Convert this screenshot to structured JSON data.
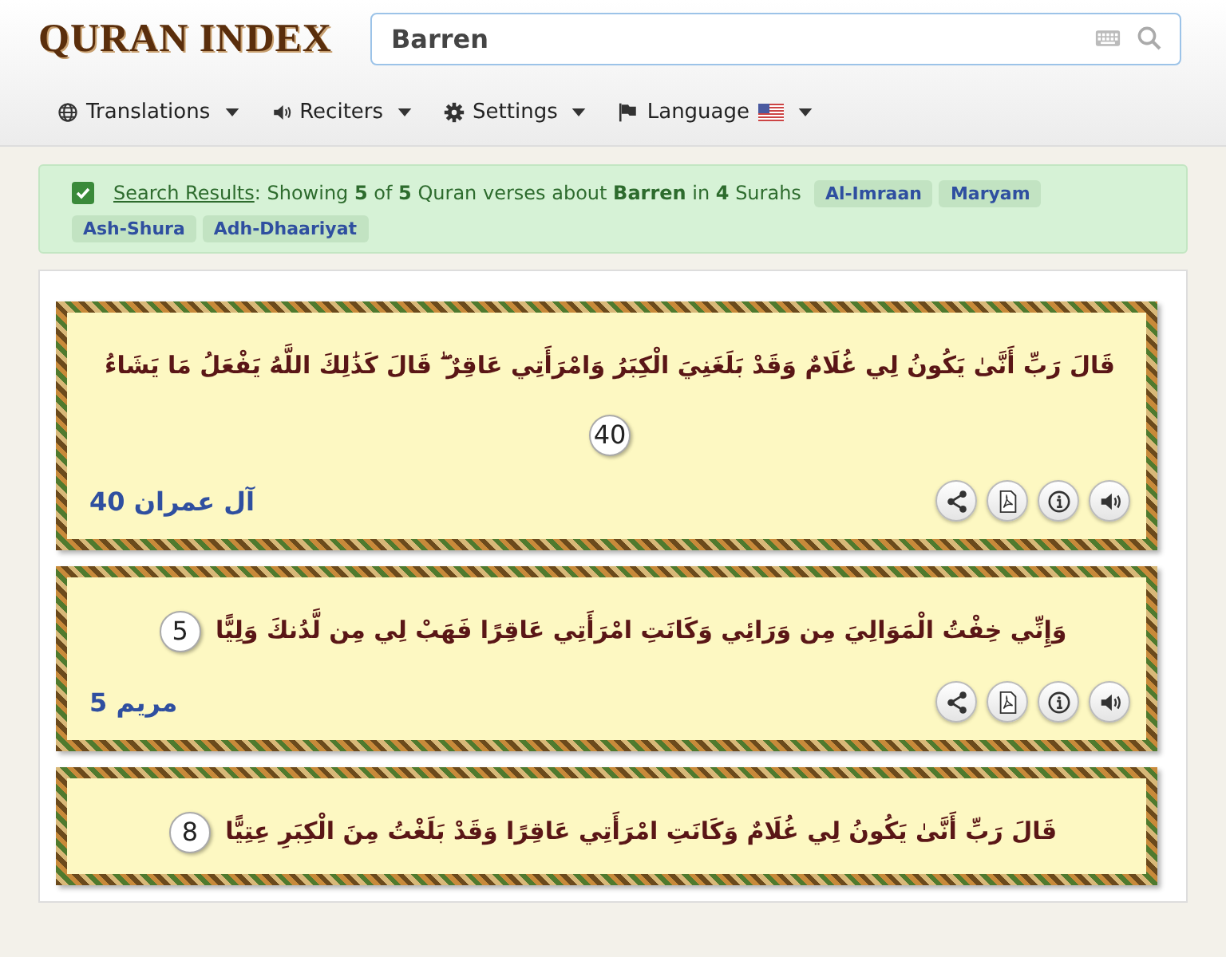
{
  "logo": "QURAN INDEX",
  "search": {
    "value": "Barren"
  },
  "menu": [
    {
      "kind": "globe",
      "label": "Translations"
    },
    {
      "kind": "speaker",
      "label": "Reciters"
    },
    {
      "kind": "gear",
      "label": "Settings"
    },
    {
      "kind": "flag",
      "label": "Language"
    }
  ],
  "summary": {
    "checked": true,
    "link": "Search Results",
    "text": ": Showing **5** of **5** Quran verses about **Barren** in **4** Surahs",
    "tags": [
      "Al-Imraan",
      "Maryam",
      "Ash-Shura",
      "Adh-Dhaariyat"
    ]
  },
  "verses": [
    {
      "text": "قَالَ رَبِّ أَنَّىٰ يَكُونُ لِي غُلَامٌ وَقَدْ بَلَغَنِيَ الْكِبَرُ وَامْرَأَتِي عَاقِرٌ ۖ قَالَ كَذَٰلِكَ اللَّهُ يَفْعَلُ مَا يَشَاءُ",
      "number": "40",
      "reference": "آل عمران 40"
    },
    {
      "text": "وَإِنِّي خِفْتُ الْمَوَالِيَ مِن وَرَائِي وَكَانَتِ امْرَأَتِي عَاقِرًا فَهَبْ لِي مِن لَّدُنكَ وَلِيًّا",
      "number": "5",
      "reference": "مريم 5"
    },
    {
      "text": "قَالَ رَبِّ أَنَّىٰ يَكُونُ لِي غُلَامٌ وَكَانَتِ امْرَأَتِي عَاقِرًا وَقَدْ بَلَغْتُ مِنَ الْكِبَرِ عِتِيًّا",
      "number": "8"
    }
  ]
}
